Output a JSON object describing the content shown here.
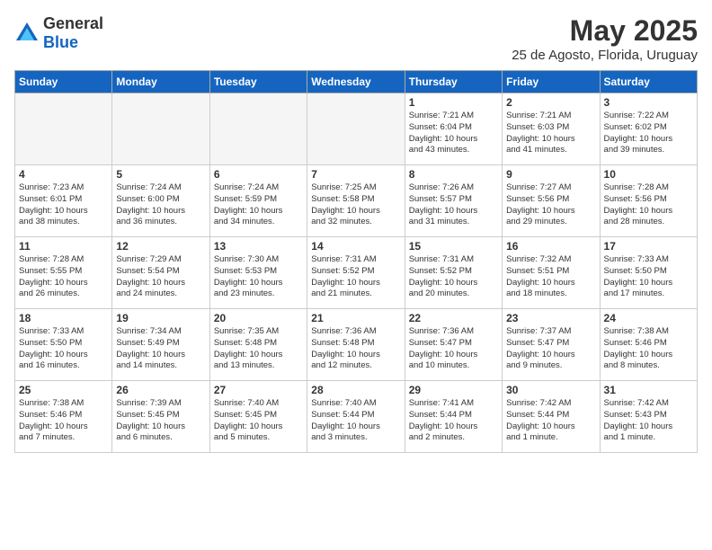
{
  "header": {
    "logo_general": "General",
    "logo_blue": "Blue",
    "month_title": "May 2025",
    "subtitle": "25 de Agosto, Florida, Uruguay"
  },
  "days_of_week": [
    "Sunday",
    "Monday",
    "Tuesday",
    "Wednesday",
    "Thursday",
    "Friday",
    "Saturday"
  ],
  "weeks": [
    [
      {
        "day": "",
        "info": "",
        "empty": true
      },
      {
        "day": "",
        "info": "",
        "empty": true
      },
      {
        "day": "",
        "info": "",
        "empty": true
      },
      {
        "day": "",
        "info": "",
        "empty": true
      },
      {
        "day": "1",
        "info": "Sunrise: 7:21 AM\nSunset: 6:04 PM\nDaylight: 10 hours\nand 43 minutes."
      },
      {
        "day": "2",
        "info": "Sunrise: 7:21 AM\nSunset: 6:03 PM\nDaylight: 10 hours\nand 41 minutes."
      },
      {
        "day": "3",
        "info": "Sunrise: 7:22 AM\nSunset: 6:02 PM\nDaylight: 10 hours\nand 39 minutes."
      }
    ],
    [
      {
        "day": "4",
        "info": "Sunrise: 7:23 AM\nSunset: 6:01 PM\nDaylight: 10 hours\nand 38 minutes."
      },
      {
        "day": "5",
        "info": "Sunrise: 7:24 AM\nSunset: 6:00 PM\nDaylight: 10 hours\nand 36 minutes."
      },
      {
        "day": "6",
        "info": "Sunrise: 7:24 AM\nSunset: 5:59 PM\nDaylight: 10 hours\nand 34 minutes."
      },
      {
        "day": "7",
        "info": "Sunrise: 7:25 AM\nSunset: 5:58 PM\nDaylight: 10 hours\nand 32 minutes."
      },
      {
        "day": "8",
        "info": "Sunrise: 7:26 AM\nSunset: 5:57 PM\nDaylight: 10 hours\nand 31 minutes."
      },
      {
        "day": "9",
        "info": "Sunrise: 7:27 AM\nSunset: 5:56 PM\nDaylight: 10 hours\nand 29 minutes."
      },
      {
        "day": "10",
        "info": "Sunrise: 7:28 AM\nSunset: 5:56 PM\nDaylight: 10 hours\nand 28 minutes."
      }
    ],
    [
      {
        "day": "11",
        "info": "Sunrise: 7:28 AM\nSunset: 5:55 PM\nDaylight: 10 hours\nand 26 minutes."
      },
      {
        "day": "12",
        "info": "Sunrise: 7:29 AM\nSunset: 5:54 PM\nDaylight: 10 hours\nand 24 minutes."
      },
      {
        "day": "13",
        "info": "Sunrise: 7:30 AM\nSunset: 5:53 PM\nDaylight: 10 hours\nand 23 minutes."
      },
      {
        "day": "14",
        "info": "Sunrise: 7:31 AM\nSunset: 5:52 PM\nDaylight: 10 hours\nand 21 minutes."
      },
      {
        "day": "15",
        "info": "Sunrise: 7:31 AM\nSunset: 5:52 PM\nDaylight: 10 hours\nand 20 minutes."
      },
      {
        "day": "16",
        "info": "Sunrise: 7:32 AM\nSunset: 5:51 PM\nDaylight: 10 hours\nand 18 minutes."
      },
      {
        "day": "17",
        "info": "Sunrise: 7:33 AM\nSunset: 5:50 PM\nDaylight: 10 hours\nand 17 minutes."
      }
    ],
    [
      {
        "day": "18",
        "info": "Sunrise: 7:33 AM\nSunset: 5:50 PM\nDaylight: 10 hours\nand 16 minutes."
      },
      {
        "day": "19",
        "info": "Sunrise: 7:34 AM\nSunset: 5:49 PM\nDaylight: 10 hours\nand 14 minutes."
      },
      {
        "day": "20",
        "info": "Sunrise: 7:35 AM\nSunset: 5:48 PM\nDaylight: 10 hours\nand 13 minutes."
      },
      {
        "day": "21",
        "info": "Sunrise: 7:36 AM\nSunset: 5:48 PM\nDaylight: 10 hours\nand 12 minutes."
      },
      {
        "day": "22",
        "info": "Sunrise: 7:36 AM\nSunset: 5:47 PM\nDaylight: 10 hours\nand 10 minutes."
      },
      {
        "day": "23",
        "info": "Sunrise: 7:37 AM\nSunset: 5:47 PM\nDaylight: 10 hours\nand 9 minutes."
      },
      {
        "day": "24",
        "info": "Sunrise: 7:38 AM\nSunset: 5:46 PM\nDaylight: 10 hours\nand 8 minutes."
      }
    ],
    [
      {
        "day": "25",
        "info": "Sunrise: 7:38 AM\nSunset: 5:46 PM\nDaylight: 10 hours\nand 7 minutes."
      },
      {
        "day": "26",
        "info": "Sunrise: 7:39 AM\nSunset: 5:45 PM\nDaylight: 10 hours\nand 6 minutes."
      },
      {
        "day": "27",
        "info": "Sunrise: 7:40 AM\nSunset: 5:45 PM\nDaylight: 10 hours\nand 5 minutes."
      },
      {
        "day": "28",
        "info": "Sunrise: 7:40 AM\nSunset: 5:44 PM\nDaylight: 10 hours\nand 3 minutes."
      },
      {
        "day": "29",
        "info": "Sunrise: 7:41 AM\nSunset: 5:44 PM\nDaylight: 10 hours\nand 2 minutes."
      },
      {
        "day": "30",
        "info": "Sunrise: 7:42 AM\nSunset: 5:44 PM\nDaylight: 10 hours\nand 1 minute."
      },
      {
        "day": "31",
        "info": "Sunrise: 7:42 AM\nSunset: 5:43 PM\nDaylight: 10 hours\nand 1 minute."
      }
    ]
  ]
}
